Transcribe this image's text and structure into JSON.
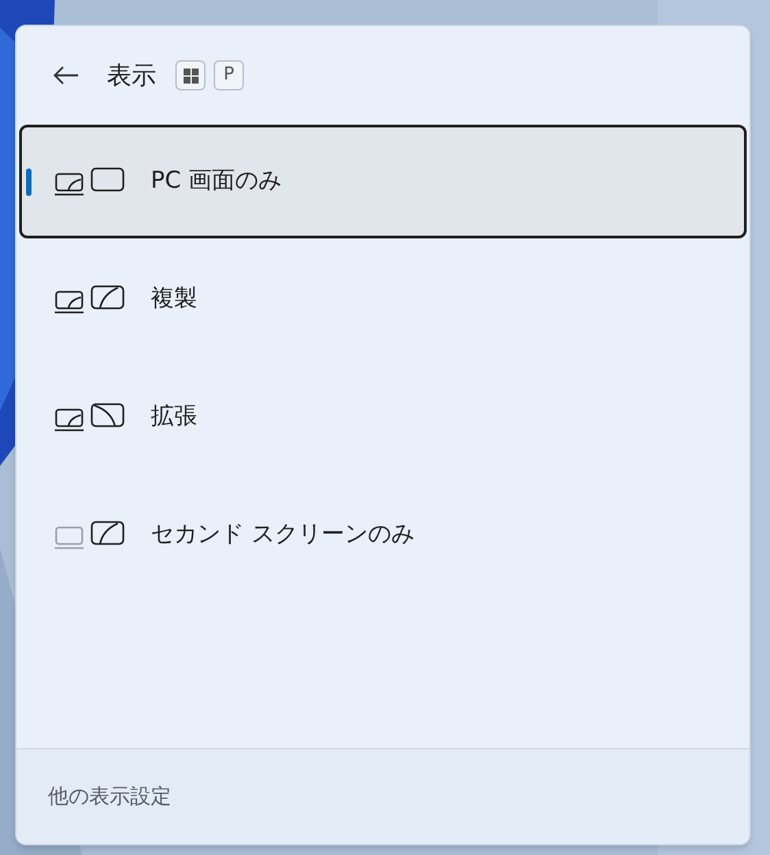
{
  "header": {
    "title": "表示",
    "keys": [
      {
        "kind": "windows"
      },
      {
        "kind": "text",
        "label": "P"
      }
    ]
  },
  "options": [
    {
      "label": "PC 画面のみ",
      "kind": "pc_only",
      "selected": true
    },
    {
      "label": "複製",
      "kind": "duplicate",
      "selected": false
    },
    {
      "label": "拡張",
      "kind": "extend",
      "selected": false
    },
    {
      "label": "セカンド スクリーンのみ",
      "kind": "second_only",
      "selected": false
    }
  ],
  "footer": {
    "link": "他の表示設定"
  }
}
